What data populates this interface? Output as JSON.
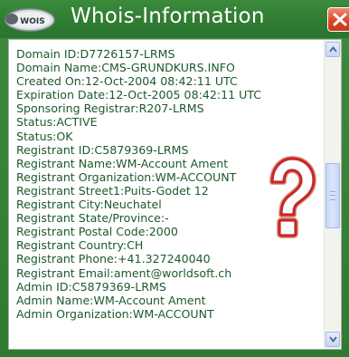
{
  "window": {
    "title": "Whois-Information",
    "logo_text": "WOIS",
    "logo_icon": "magnifier-icon",
    "close_icon": "close-icon"
  },
  "colors": {
    "title_bar": "#2f7a32",
    "text": "#1c5a2a",
    "close_button": "#d9482a",
    "question_mark": "#c62828"
  },
  "whois": {
    "lines": [
      "Domain ID:D7726157-LRMS",
      "Domain Name:CMS-GRUNDKURS.INFO",
      "Created On:12-Oct-2004 08:42:11 UTC",
      "Expiration Date:12-Oct-2005 08:42:11 UTC",
      "Sponsoring Registrar:R207-LRMS",
      "Status:ACTIVE",
      "Status:OK",
      "Registrant ID:C5879369-LRMS",
      "Registrant Name:WM-Account Ament",
      "Registrant Organization:WM-ACCOUNT",
      "Registrant Street1:Puits-Godet 12",
      "Registrant City:Neuchatel",
      "Registrant State/Province:-",
      "Registrant Postal Code:2000",
      "Registrant Country:CH",
      "Registrant Phone:+41.327240040",
      "Registrant Email:ament@worldsoft.ch",
      "Admin ID:C5879369-LRMS",
      "Admin Name:WM-Account Ament",
      "Admin Organization:WM-ACCOUNT"
    ]
  },
  "scrollbar": {
    "up_icon": "arrow-up-icon",
    "down_icon": "arrow-down-icon",
    "position": 0.45
  },
  "decoration": {
    "question_icon": "question-mark-icon"
  }
}
